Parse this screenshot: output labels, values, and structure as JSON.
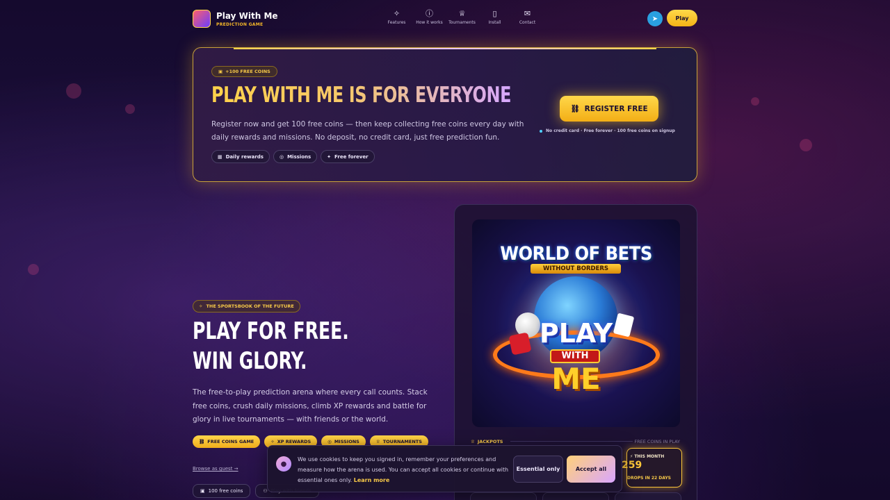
{
  "header": {
    "brand_name": "Play With Me",
    "brand_sub": "PREDICTION GAME",
    "nav": [
      {
        "label": "Features",
        "icon": "sparkle-icon"
      },
      {
        "label": "How it works",
        "icon": "question-icon"
      },
      {
        "label": "Tournaments",
        "icon": "trophy-icon"
      },
      {
        "label": "Install",
        "icon": "phone-icon"
      },
      {
        "label": "Contact",
        "icon": "mail-icon"
      }
    ],
    "play_label": "Play"
  },
  "banner": {
    "pill": "+100 FREE COINS",
    "title": "PLAY WITH ME IS FOR EVERYONE",
    "description": "Register now and get 100 free coins — then keep collecting free coins every day with daily rewards and missions. No deposit, no credit card, just free prediction fun.",
    "chips": [
      "Daily rewards",
      "Missions",
      "Free forever"
    ],
    "register_label": "REGISTER FREE",
    "register_note": "No credit card · Free forever · 100 free coins on signup"
  },
  "hero": {
    "tag": "THE SPORTSBOOK OF THE FUTURE",
    "title_line1": "PLAY FOR FREE.",
    "title_line2": "WIN GLORY.",
    "description": "The free-to-play prediction arena where every call counts. Stack free coins, crush daily missions, climb XP rewards and battle for glory in live tournaments — with friends or the world.",
    "tags": [
      "FREE COINS GAME",
      "XP REWARDS",
      "MISSIONS",
      "TOURNAMENTS"
    ],
    "guest_link": "Browse as guest →",
    "bottom_chips": [
      "100 free coins",
      "Play with friends"
    ]
  },
  "poster": {
    "title": "WORLD OF BETS",
    "ribbon": "WITHOUT BORDERS",
    "play": "PLAY",
    "with": "WITH",
    "me": "ME"
  },
  "jackpots": {
    "label": "JACKPOTS",
    "right_label": "FREE COINS IN PLAY",
    "box_label": "THIS MONTH",
    "box_value": "259",
    "box_sub": "DROPS IN 22 DAYS"
  },
  "cookie": {
    "text": "We use cookies to keep you signed in, remember your preferences and measure how the arena is used. You can accept all cookies or continue with essential ones only.",
    "learn_more": "Learn more",
    "essential_label": "Essential only",
    "accept_label": "Accept all"
  }
}
